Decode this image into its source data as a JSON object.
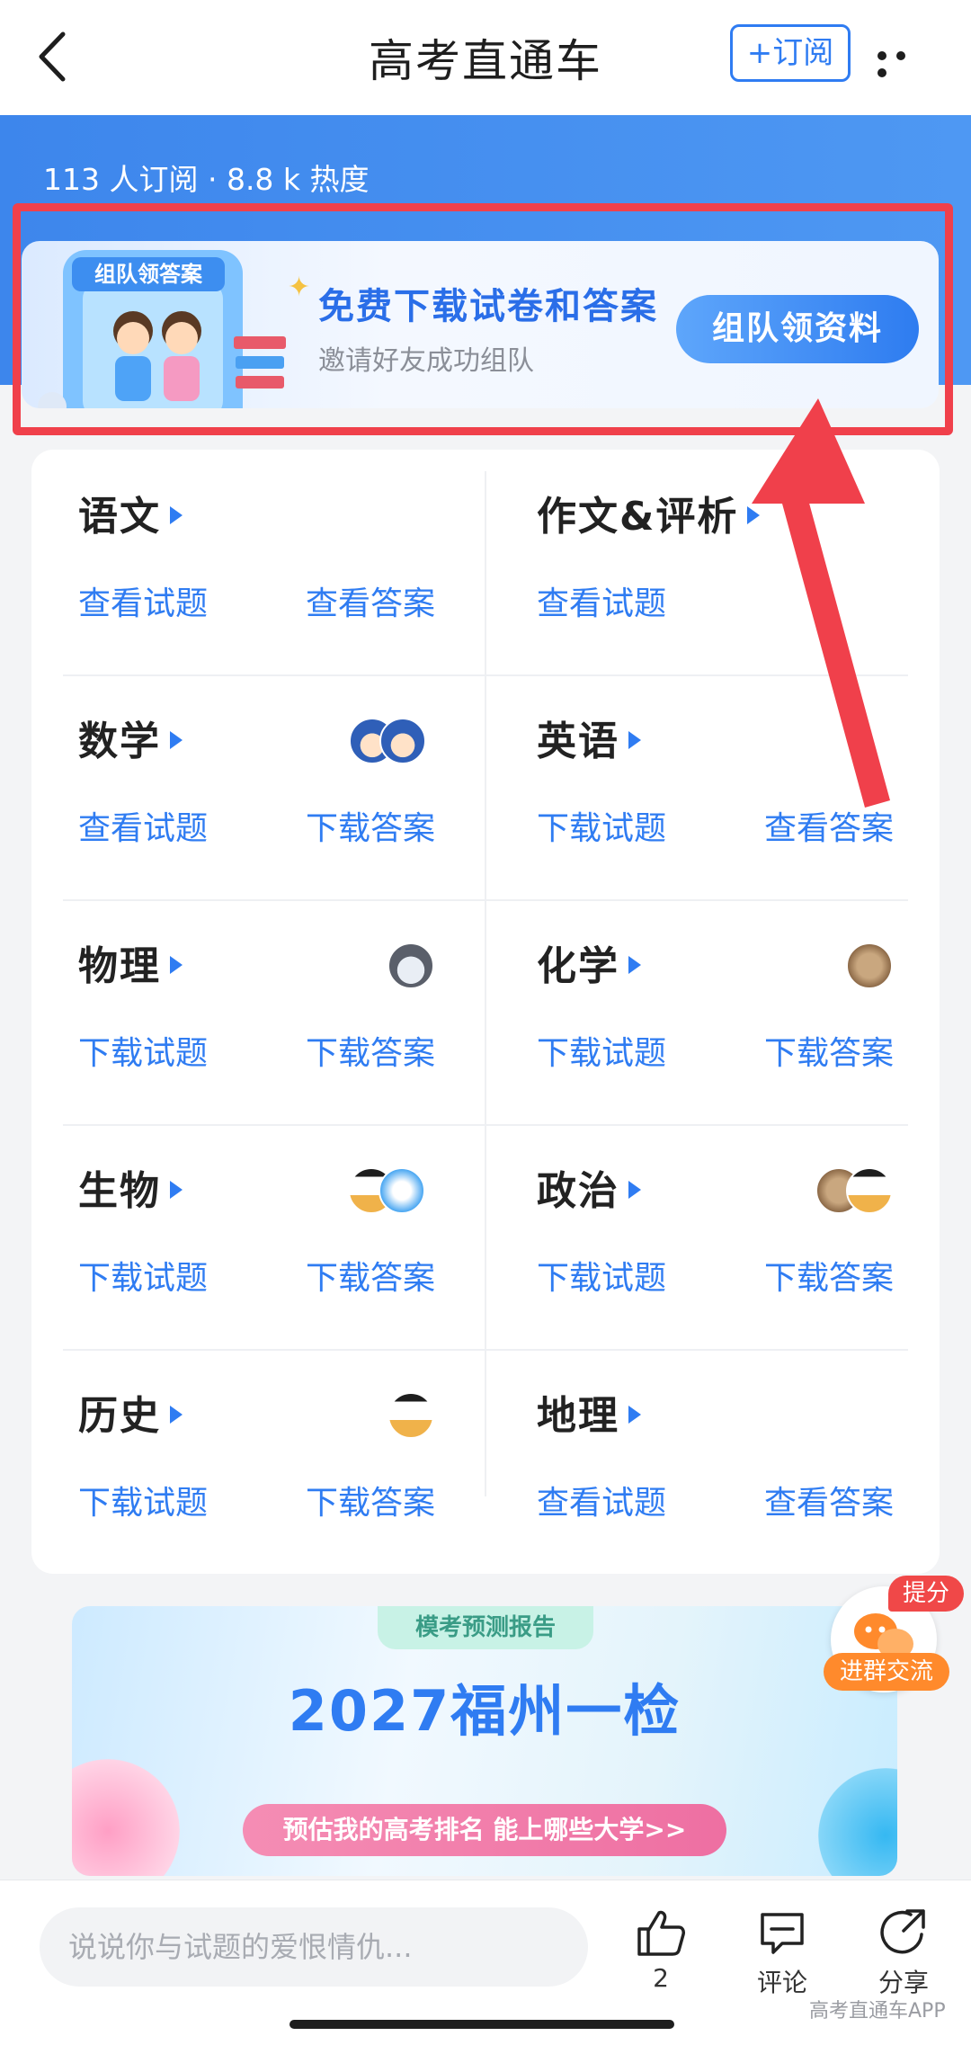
{
  "nav": {
    "title": "高考直通车",
    "subscribe_label": "+订阅"
  },
  "stats": "113 人订阅 · 8.8 k 热度",
  "banner": {
    "heading": "免费下载试卷和答案",
    "subheading": "邀请好友成功组队",
    "button": "组队领资料",
    "art_text": "组队领答案"
  },
  "subjects": [
    {
      "name": "语文",
      "links": [
        "查看试题",
        "查看答案"
      ]
    },
    {
      "name": "作文&评析",
      "links": [
        "查看试题"
      ]
    },
    {
      "name": "数学",
      "links": [
        "查看试题",
        "下载答案"
      ]
    },
    {
      "name": "英语",
      "links": [
        "下载试题",
        "查看答案"
      ]
    },
    {
      "name": "物理",
      "links": [
        "下载试题",
        "下载答案"
      ]
    },
    {
      "name": "化学",
      "links": [
        "下载试题",
        "下载答案"
      ]
    },
    {
      "name": "生物",
      "links": [
        "下载试题",
        "下载答案"
      ]
    },
    {
      "name": "政治",
      "links": [
        "下载试题",
        "下载答案"
      ]
    },
    {
      "name": "历史",
      "links": [
        "下载试题",
        "下载答案"
      ]
    },
    {
      "name": "地理",
      "links": [
        "查看试题",
        "查看答案"
      ]
    }
  ],
  "float_widget": {
    "badge": "提分",
    "label": "进群交流"
  },
  "promo": {
    "tag": "模考预测报告",
    "title": "2027福州一检",
    "button": "预估我的高考排名 能上哪些大学>>"
  },
  "bottom": {
    "placeholder": "说说你与试题的爱恨情仇...",
    "like_count": "2",
    "comment_label": "评论",
    "share_label": "分享"
  },
  "watermark": "高考直通车APP",
  "colors": {
    "accent": "#2f7cf2",
    "highlight": "#f0404b",
    "hero": "#4590ef"
  },
  "icons": [
    "back-arrow-icon",
    "more-icon",
    "play-triangle-icon",
    "like-icon",
    "comment-icon",
    "share-icon",
    "wechat-group-icon"
  ]
}
